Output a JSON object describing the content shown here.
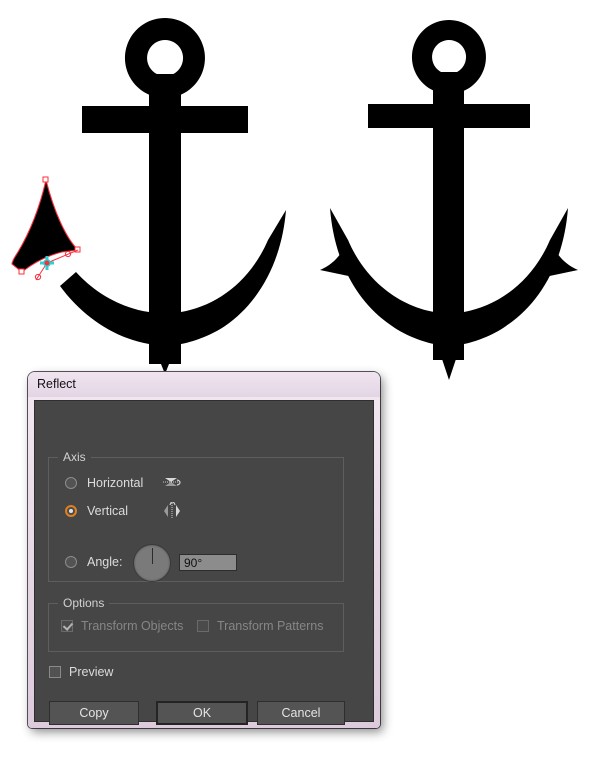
{
  "canvas": {
    "artwork_name": "anchor-illustration",
    "shapes": [
      {
        "name": "anchor-left-partial",
        "description": "anchor missing right fluke"
      },
      {
        "name": "selected-fluke",
        "description": "selected mirrored fluke path with anchor points"
      },
      {
        "name": "anchor-right-complete",
        "description": "complete anchor with both flukes"
      }
    ],
    "selection": {
      "path_color": "#ff2d3c",
      "anchor_point_color": "#ff2d3c",
      "reference_point_color": "#25d4d4"
    }
  },
  "dialog": {
    "title": "Reflect",
    "axis": {
      "group_label": "Axis",
      "options": [
        {
          "id": "horizontal",
          "label": "Horizontal",
          "selected": false,
          "icon": "reflect-horizontal-icon"
        },
        {
          "id": "vertical",
          "label": "Vertical",
          "selected": true,
          "icon": "reflect-vertical-icon"
        },
        {
          "id": "angle",
          "label": "Angle:",
          "selected": false,
          "icon": "angle-dial-icon"
        }
      ],
      "angle_value": "90°",
      "angle_dial_degrees": 90,
      "selected_accent_color": "#e08020"
    },
    "options": {
      "group_label": "Options",
      "checkboxes": [
        {
          "id": "transform-objects",
          "label": "Transform Objects",
          "checked": true,
          "disabled": true
        },
        {
          "id": "transform-patterns",
          "label": "Transform Patterns",
          "checked": false,
          "disabled": true
        }
      ]
    },
    "preview": {
      "label": "Preview",
      "checked": false
    },
    "buttons": [
      {
        "id": "copy",
        "label": "Copy",
        "default": false
      },
      {
        "id": "ok",
        "label": "OK",
        "default": true
      },
      {
        "id": "cancel",
        "label": "Cancel",
        "default": false
      }
    ],
    "colors": {
      "titlebar": "#e9dcea",
      "body": "#464646",
      "text": "#dcdcdc",
      "disabled_text": "#868686",
      "accent": "#e08020"
    }
  }
}
